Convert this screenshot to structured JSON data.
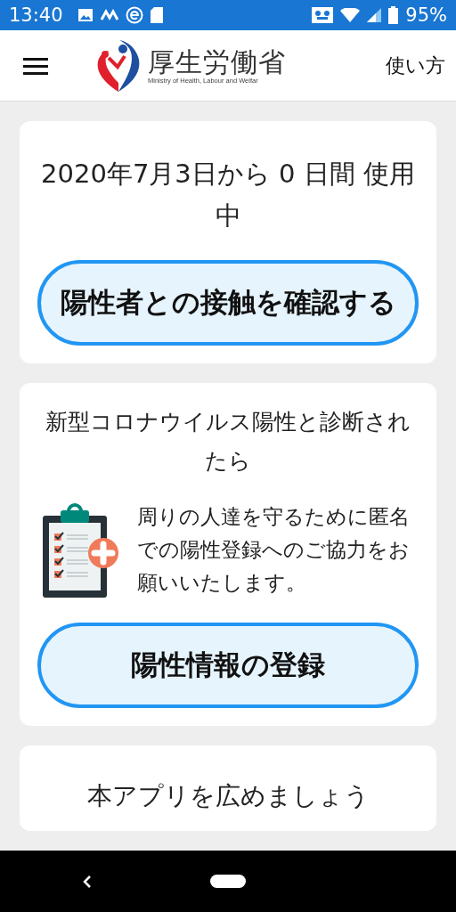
{
  "status_bar": {
    "time": "13:40",
    "battery": "95%"
  },
  "header": {
    "logo_title": "厚生労働省",
    "logo_subtitle": "Ministry of Health, Labour and Welfar",
    "help_link": "使い方"
  },
  "cards": [
    {
      "kind": "status",
      "title": "2020年7月3日から 0 日間 使用中",
      "button": "陽性者との接触を確認する"
    },
    {
      "kind": "register",
      "title": "新型コロナウイルス陽性と診断されたら",
      "text": "周りの人達を守るために匿名での陽性登録へのご協力をお願いいたします。",
      "button": "陽性情報の登録"
    },
    {
      "kind": "share",
      "title": "本アプリを広めましょう"
    }
  ]
}
